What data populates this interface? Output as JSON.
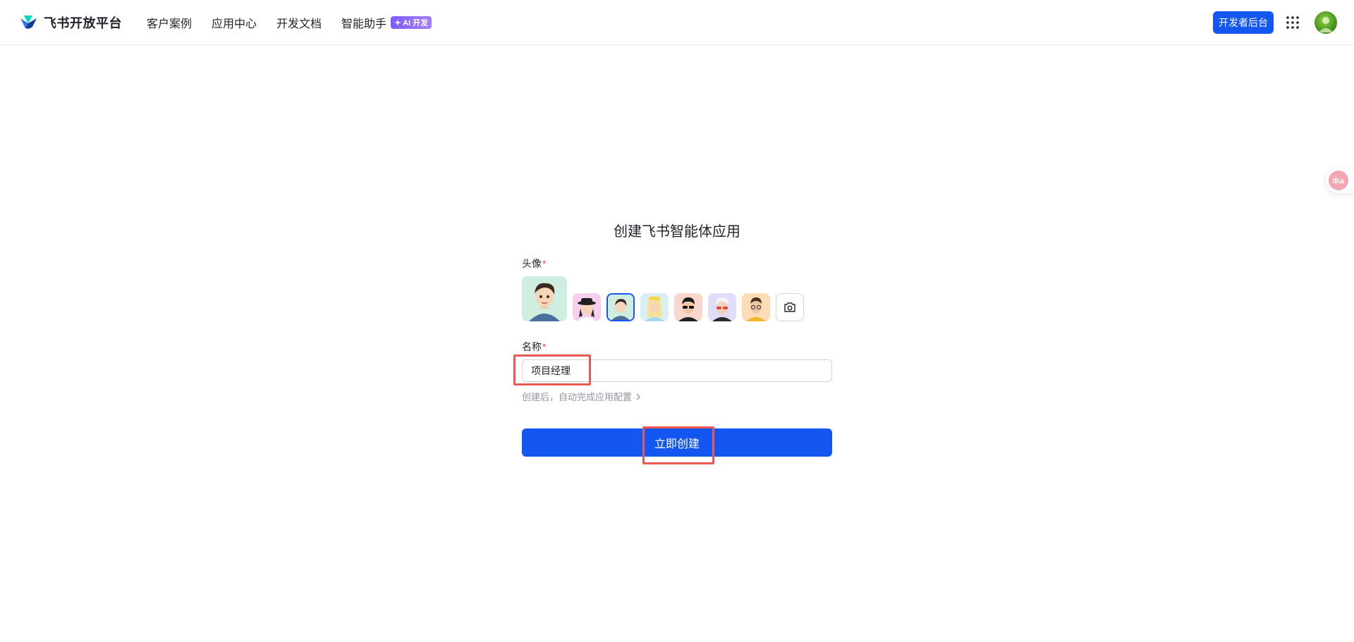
{
  "header": {
    "brand": "飞书开放平台",
    "nav": [
      {
        "label": "客户案例"
      },
      {
        "label": "应用中心"
      },
      {
        "label": "开发文档"
      },
      {
        "label": "智能助手",
        "badge": "AI 开发"
      }
    ],
    "dev_console": "开发者后台"
  },
  "translate": {
    "label": "中A"
  },
  "form": {
    "title": "创建飞书智能体应用",
    "avatar_label": "头像",
    "name_label": "名称",
    "required_mark": "*",
    "name_value": "项目经理",
    "hint": "创建后，自动完成应用配置",
    "submit": "立即创建"
  },
  "colors": {
    "primary": "#1456f0",
    "required": "#f54a45",
    "highlight": "#ea5a55"
  }
}
